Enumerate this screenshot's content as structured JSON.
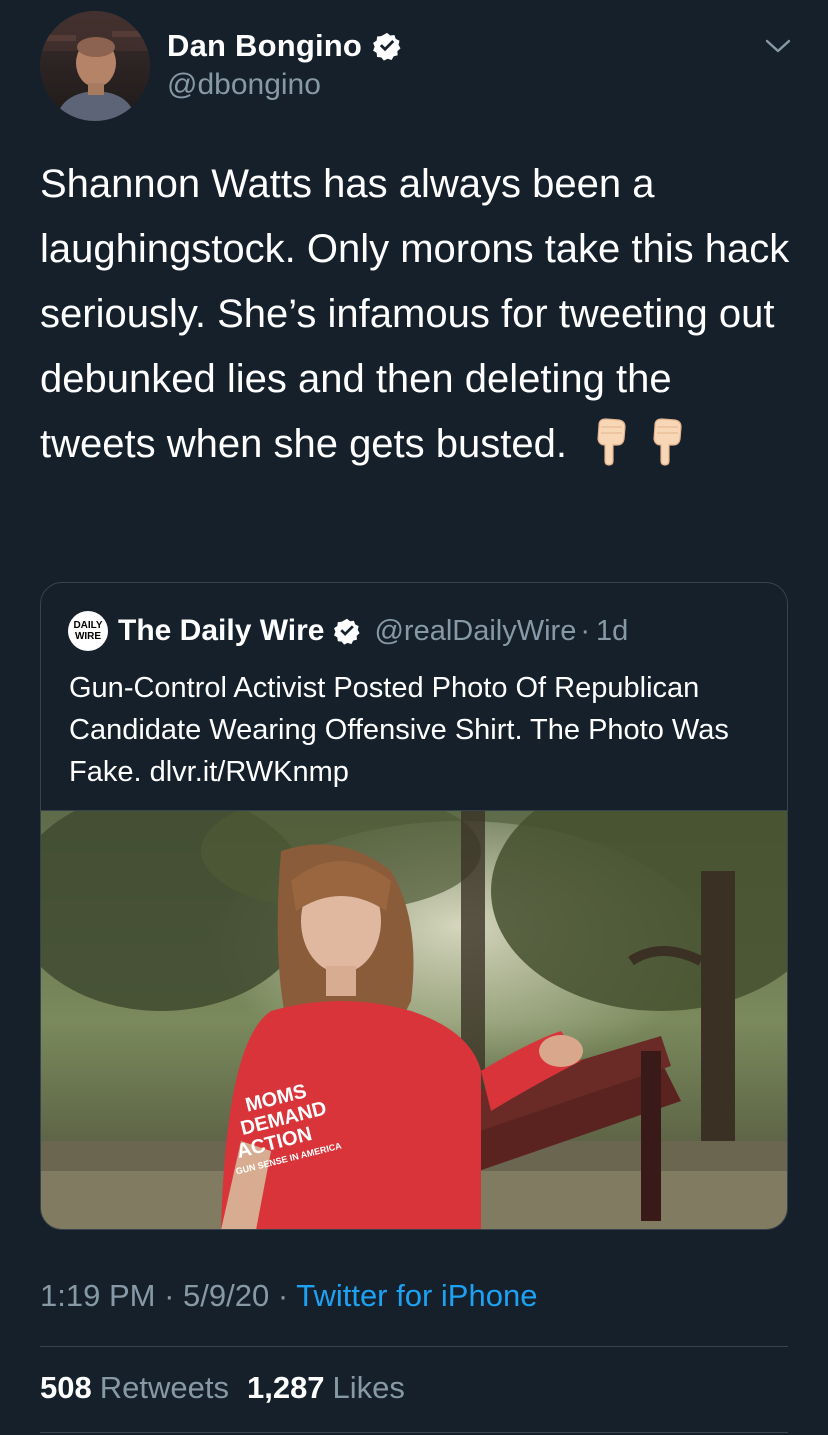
{
  "author": {
    "display_name": "Dan Bongino",
    "handle": "@dbongino",
    "verified": true,
    "avatar_icon": "user-avatar-photo"
  },
  "tweet": {
    "text": "Shannon Watts has always been a laughingstock. Only morons take this hack seriously. She’s infamous for tweeting out debunked lies and then deleting the tweets when she gets busted.",
    "emojis": [
      "backhand-index-pointing-down",
      "backhand-index-pointing-down"
    ]
  },
  "quoted_tweet": {
    "logo_text_top": "DAILY",
    "logo_text_bottom": "WIRE",
    "display_name": "The Daily Wire",
    "handle": "@realDailyWire",
    "separator": "·",
    "time_ago": "1d",
    "text": "Gun-Control Activist Posted Photo Of Republican Candidate Wearing Offensive Shirt. The Photo Was Fake. dlvr.it/RWKnmp",
    "image_icon": "photo-woman-on-park-bench",
    "shirt_text_1": "MOMS",
    "shirt_text_2": "DEMAND",
    "shirt_text_3": "ACTION",
    "shirt_text_4": "GUN SENSE IN AMERICA"
  },
  "meta": {
    "time": "1:19 PM",
    "separator": " · ",
    "date": "5/9/20",
    "source": "Twitter for iPhone"
  },
  "stats": {
    "retweets_count": "508",
    "retweets_label": "Retweets",
    "likes_count": "1,287",
    "likes_label": "Likes"
  },
  "colors": {
    "background": "#15202b",
    "secondary_text": "#8899a6",
    "link": "#1da1f2",
    "border": "#38444d",
    "verified_badge": "#ffffff"
  }
}
